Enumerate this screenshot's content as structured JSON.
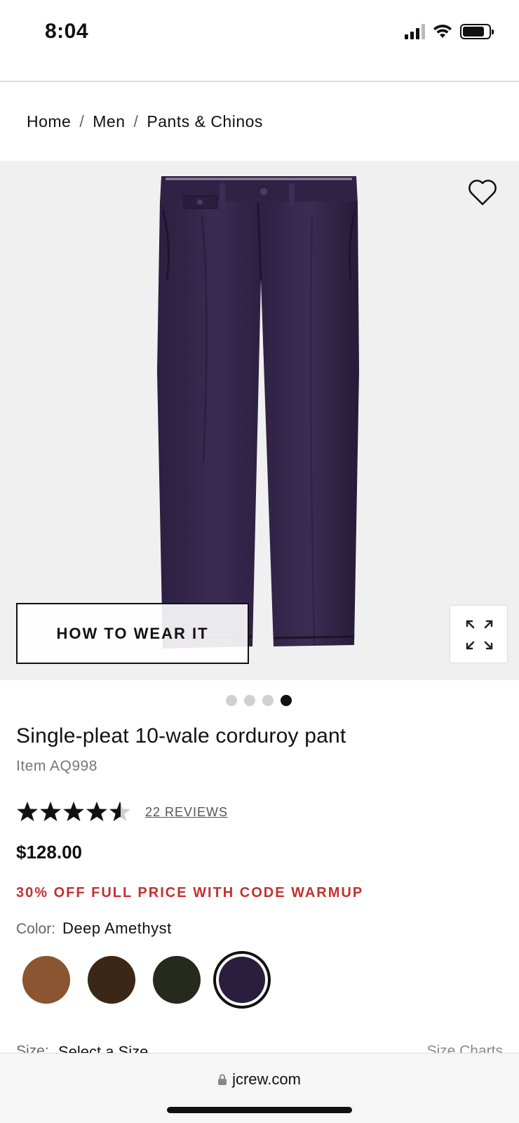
{
  "status_bar": {
    "time": "8:04"
  },
  "breadcrumb": {
    "items": [
      "Home",
      "Men",
      "Pants & Chinos"
    ],
    "separator": "/"
  },
  "gallery": {
    "how_to_wear_label": "HOW TO WEAR IT",
    "dots_total": 4,
    "active_dot": 4
  },
  "product": {
    "title": "Single-pleat 10-wale corduroy pant",
    "item_number": "Item AQ998",
    "rating": 4.5,
    "reviews_label": "22 REVIEWS",
    "price": "$128.00",
    "promo": "30% OFF FULL PRICE WITH CODE WARMUP",
    "color_label": "Color:",
    "color_value": "Deep Amethyst",
    "swatches": [
      {
        "name": "tan-brown",
        "color": "#8a5530"
      },
      {
        "name": "dark-brown",
        "color": "#3a2716"
      },
      {
        "name": "dark-olive",
        "color": "#262a1d"
      },
      {
        "name": "deep-amethyst",
        "color": "#2b1d3d",
        "selected": true
      }
    ],
    "size_label": "Size:",
    "size_value": "Select a Size",
    "size_charts_label": "Size Charts"
  },
  "browser": {
    "url": "jcrew.com"
  },
  "colors": {
    "promo": "#c2312f",
    "pants": "#33244a"
  }
}
